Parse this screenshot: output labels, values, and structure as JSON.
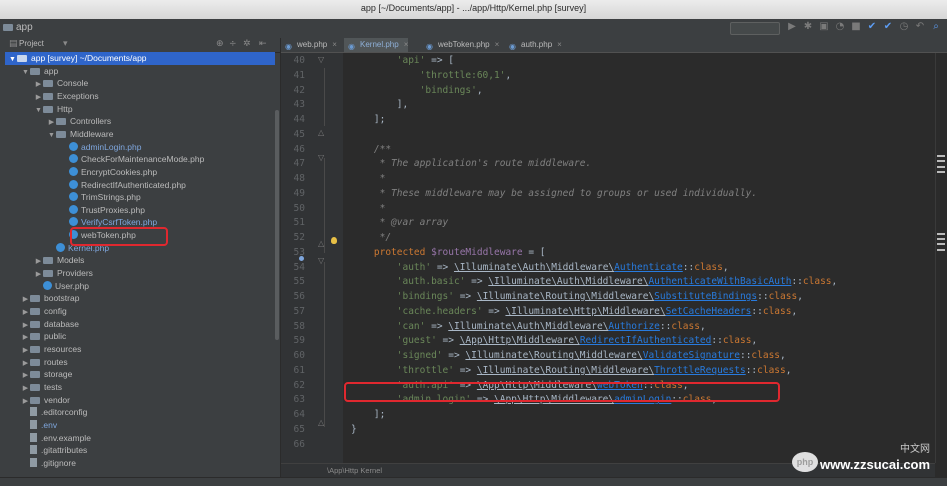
{
  "window": {
    "title": "app [~/Documents/app] - .../app/Http/Kernel.php [survey]",
    "navbar_crumb": "app"
  },
  "toolbar": {
    "icons": [
      "run-icon",
      "debug-icon",
      "coverage-icon",
      "profile-icon",
      "stop-icon",
      "vcs-update-icon",
      "vcs-commit-icon",
      "history-icon",
      "revert-icon",
      "search-everywhere-icon"
    ]
  },
  "sidebar": {
    "header": "Project",
    "tree": [
      {
        "label": "app [survey] ~/Documents/app",
        "type": "folder",
        "arrow": "▼",
        "indent": 0,
        "selected": true
      },
      {
        "label": "app",
        "type": "folder",
        "arrow": "▼",
        "indent": 1
      },
      {
        "label": "Console",
        "type": "folder",
        "arrow": "▶",
        "indent": 2
      },
      {
        "label": "Exceptions",
        "type": "folder",
        "arrow": "▶",
        "indent": 2
      },
      {
        "label": "Http",
        "type": "folder",
        "arrow": "▼",
        "indent": 2
      },
      {
        "label": "Controllers",
        "type": "folder",
        "arrow": "▶",
        "indent": 3
      },
      {
        "label": "Middleware",
        "type": "folder",
        "arrow": "▼",
        "indent": 3
      },
      {
        "label": "adminLogin.php",
        "type": "php",
        "indent": 4,
        "blue": true
      },
      {
        "label": "CheckForMaintenanceMode.php",
        "type": "php",
        "indent": 4
      },
      {
        "label": "EncryptCookies.php",
        "type": "php",
        "indent": 4
      },
      {
        "label": "RedirectIfAuthenticated.php",
        "type": "php",
        "indent": 4
      },
      {
        "label": "TrimStrings.php",
        "type": "php",
        "indent": 4
      },
      {
        "label": "TrustProxies.php",
        "type": "php",
        "indent": 4
      },
      {
        "label": "VerifyCsrfToken.php",
        "type": "php",
        "indent": 4,
        "blue": true
      },
      {
        "label": "webToken.php",
        "type": "php",
        "indent": 4,
        "boxed": true
      },
      {
        "label": "Kernel.php",
        "type": "php",
        "indent": 3,
        "blue": true
      },
      {
        "label": "Models",
        "type": "folder",
        "arrow": "▶",
        "indent": 2
      },
      {
        "label": "Providers",
        "type": "folder",
        "arrow": "▶",
        "indent": 2
      },
      {
        "label": "User.php",
        "type": "php",
        "indent": 2
      },
      {
        "label": "bootstrap",
        "type": "folder",
        "arrow": "▶",
        "indent": 1
      },
      {
        "label": "config",
        "type": "folder",
        "arrow": "▶",
        "indent": 1
      },
      {
        "label": "database",
        "type": "folder",
        "arrow": "▶",
        "indent": 1
      },
      {
        "label": "public",
        "type": "folder",
        "arrow": "▶",
        "indent": 1
      },
      {
        "label": "resources",
        "type": "folder",
        "arrow": "▶",
        "indent": 1
      },
      {
        "label": "routes",
        "type": "folder",
        "arrow": "▶",
        "indent": 1
      },
      {
        "label": "storage",
        "type": "folder",
        "arrow": "▶",
        "indent": 1
      },
      {
        "label": "tests",
        "type": "folder",
        "arrow": "▶",
        "indent": 1
      },
      {
        "label": "vendor",
        "type": "folder",
        "arrow": "▶",
        "indent": 1
      },
      {
        "label": ".editorconfig",
        "type": "file",
        "indent": 1
      },
      {
        "label": ".env",
        "type": "file",
        "indent": 1,
        "blue": true
      },
      {
        "label": ".env.example",
        "type": "file",
        "indent": 1
      },
      {
        "label": ".gitattributes",
        "type": "file",
        "indent": 1
      },
      {
        "label": ".gitignore",
        "type": "file",
        "indent": 1
      }
    ]
  },
  "tabs": [
    {
      "label": "web.php",
      "active": false
    },
    {
      "label": "Kernel.php",
      "active": true
    },
    {
      "label": "webToken.php",
      "active": false
    },
    {
      "label": "auth.php",
      "active": false
    }
  ],
  "editor": {
    "breadcrumb": "\\App\\Http     Kernel",
    "lines": [
      {
        "n": "40",
        "html": "        <span class=\"s\">'api'</span> => ["
      },
      {
        "n": "41",
        "html": "            <span class=\"s\">'throttle:60,1'</span>,"
      },
      {
        "n": "42",
        "html": "            <span class=\"s\">'bindings'</span>,"
      },
      {
        "n": "43",
        "html": "        ],"
      },
      {
        "n": "44",
        "html": "    ];"
      },
      {
        "n": "45",
        "html": ""
      },
      {
        "n": "46",
        "html": "    <span class=\"cmt\">/**</span>"
      },
      {
        "n": "47",
        "html": "<span class=\"cmt\">     * The application's route middleware.</span>"
      },
      {
        "n": "48",
        "html": "<span class=\"cmt\">     *</span>"
      },
      {
        "n": "49",
        "html": "<span class=\"cmt\">     * These middleware may be assigned to groups or used individually.</span>"
      },
      {
        "n": "50",
        "html": "<span class=\"cmt\">     *</span>"
      },
      {
        "n": "51",
        "html": "<span class=\"cmt\">     * @var array</span>"
      },
      {
        "n": "52",
        "html": "<span class=\"cmt\">     */</span>"
      },
      {
        "n": "53",
        "html": "    <span class=\"k\">protected</span> <span class=\"v\">$routeMiddleware</span> = ["
      },
      {
        "n": "54",
        "html": "        <span class=\"s\">'auth'</span> => <span class=\"u\">\\Illuminate\\Auth\\Middleware\\</span><span class=\"cls\">Authenticate</span>::<span class=\"k\">class</span>,"
      },
      {
        "n": "55",
        "html": "        <span class=\"s\">'auth.basic'</span> => <span class=\"u\">\\Illuminate\\Auth\\Middleware\\</span><span class=\"cls\">AuthenticateWithBasicAuth</span>::<span class=\"k\">class</span>,"
      },
      {
        "n": "56",
        "html": "        <span class=\"s\">'bindings'</span> => <span class=\"u\">\\Illuminate\\Routing\\Middleware\\</span><span class=\"cls\">SubstituteBindings</span>::<span class=\"k\">class</span>,"
      },
      {
        "n": "57",
        "html": "        <span class=\"s\">'cache.headers'</span> => <span class=\"u\">\\Illuminate\\Http\\Middleware\\</span><span class=\"cls\">SetCacheHeaders</span>::<span class=\"k\">class</span>,"
      },
      {
        "n": "58",
        "html": "        <span class=\"s\">'can'</span> => <span class=\"u\">\\Illuminate\\Auth\\Middleware\\</span><span class=\"cls\">Authorize</span>::<span class=\"k\">class</span>,"
      },
      {
        "n": "59",
        "html": "        <span class=\"s\">'guest'</span> => <span class=\"u\">\\App\\Http\\Middleware\\</span><span class=\"cls\">RedirectIfAuthenticated</span>::<span class=\"k\">class</span>,"
      },
      {
        "n": "60",
        "html": "        <span class=\"s\">'signed'</span> => <span class=\"u\">\\Illuminate\\Routing\\Middleware\\</span><span class=\"cls\">ValidateSignature</span>::<span class=\"k\">class</span>,"
      },
      {
        "n": "61",
        "html": "        <span class=\"s\">'throttle'</span> => <span class=\"u\">\\Illuminate\\Routing\\Middleware\\</span><span class=\"cls\">ThrottleRequests</span>::<span class=\"k\">class</span>,"
      },
      {
        "n": "62",
        "html": "        <span class=\"s\">'auth.api'</span> => <span class=\"u\">\\App\\Http\\Middleware\\</span><span class=\"cls\">webToken</span>::<span class=\"k\">class</span>,"
      },
      {
        "n": "63",
        "html": "        <span class=\"s\">'admin.login'</span> => <span class=\"u\">\\App\\Http\\Middleware\\</span><span class=\"cls\">adminLogin</span>::<span class=\"k\">class</span>,"
      },
      {
        "n": "64",
        "html": "    ];"
      },
      {
        "n": "65",
        "html": "}"
      },
      {
        "n": "66",
        "html": ""
      }
    ]
  },
  "watermark": {
    "site": "www.zzsucai.com",
    "logo": "php",
    "cn": "中文网"
  },
  "colors": {
    "highlight_box": "#e0282f",
    "selection": "#2f65ca",
    "keyword": "#cc7832",
    "string": "#6a8759",
    "comment": "#808080",
    "variable": "#9876aa",
    "class_link": "#287bde"
  }
}
